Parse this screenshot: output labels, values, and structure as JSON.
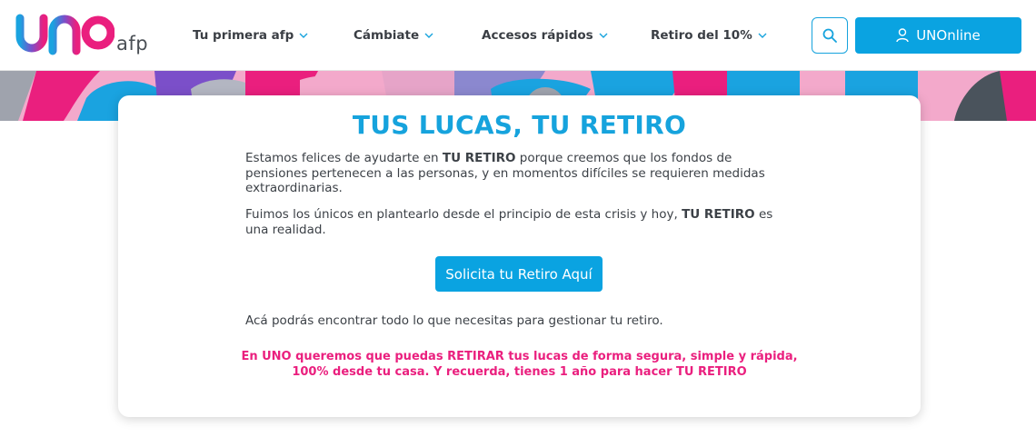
{
  "header": {
    "logo_text": "uno",
    "logo_suffix": "afp",
    "nav": [
      {
        "label": "Tu primera afp"
      },
      {
        "label": "Cámbiate"
      },
      {
        "label": "Accesos rápidos"
      },
      {
        "label": "Retiro del 10%"
      }
    ],
    "search_icon": "search-icon",
    "unonline_label": "UNOnline",
    "unonline_icon": "user-icon"
  },
  "colors": {
    "brand_blue": "#16a3dd",
    "button_blue": "#0aa3e1",
    "brand_pink": "#ea1f7e",
    "brand_purple": "#7b4fc9",
    "text_dark": "#3c4147"
  },
  "card": {
    "title": "TUS LUCAS, TU RETIRO",
    "p1_a": "Estamos felices de ayudarte en ",
    "p1_b": "TU RETIRO",
    "p1_c": " porque creemos que los fondos de pensiones pertenecen a las personas, y en momentos difíciles se requieren medidas extraordinarias.",
    "p2_a": "Fuimos los únicos en plantearlo desde el principio de esta crisis y hoy, ",
    "p2_b": "TU RETIRO",
    "p2_c": " es una realidad.",
    "cta_label": "Solicita tu Retiro Aquí",
    "p3": "Acá podrás encontrar todo lo que necesitas para gestionar tu retiro.",
    "highlight_line1": "En UNO queremos que puedas RETIRAR tus lucas de forma segura, simple y rápida,",
    "highlight_line2": "100% desde tu casa. Y recuerda, tienes 1 año para hacer TU RETIRO"
  }
}
